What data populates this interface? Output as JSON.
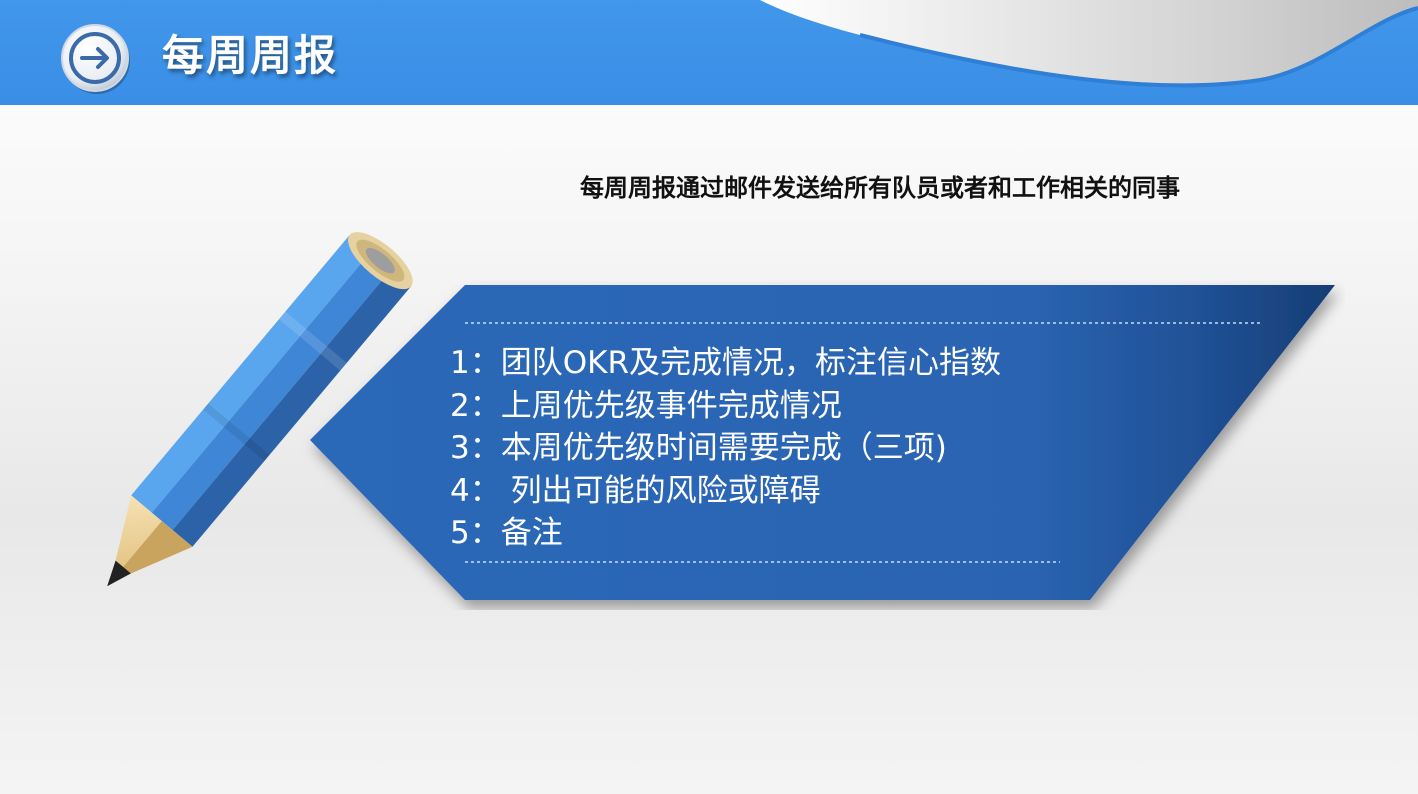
{
  "header": {
    "title": "每周周报",
    "icon": "arrow-right-icon",
    "band_color": "#3a8ee6"
  },
  "subtitle": "每周周报通过邮件发送给所有队员或者和工作相关的同事",
  "items": [
    "1：团队OKR及完成情况，标注信心指数",
    "2：上周优先级事件完成情况",
    "3：本周优先级时间需要完成（三项)",
    "4： 列出可能的风险或障碍",
    "5：备注"
  ],
  "decoration": {
    "pencil_icon": "pencil-icon",
    "banner_color": "#2b68b8"
  }
}
